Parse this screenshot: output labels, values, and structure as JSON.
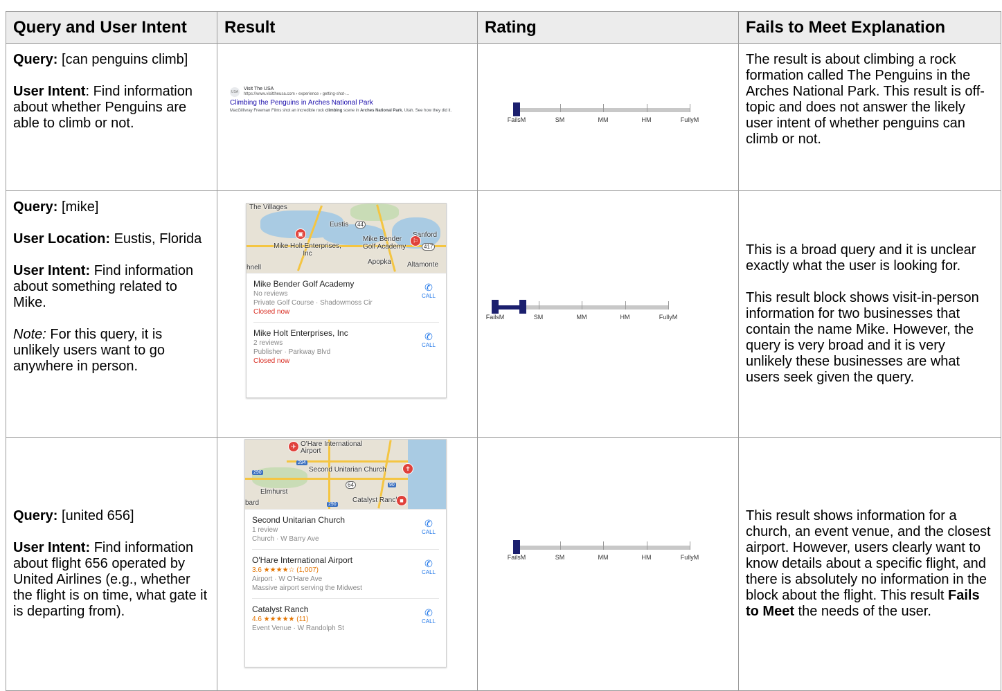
{
  "headers": [
    "Query and User Intent",
    "Result",
    "Rating",
    "Fails to Meet Explanation"
  ],
  "rows": [
    {
      "query_label": "Query:",
      "query": "[can penguins climb]",
      "intent_label": "User Intent",
      "intent": ": Find information about whether Penguins are able to climb or not.",
      "result": {
        "favicon": "USA",
        "site": "Visit The USA",
        "url": "https://www.visittheusa.com › experience › getting-shot-...",
        "title": "Climbing the Penguins in Arches National Park",
        "desc_a": "MacGillivray Freeman Films shot an incredible rock ",
        "desc_b": "climbing",
        "desc_c": " scene in ",
        "desc_d": "Arches National Park",
        "desc_e": ", Utah. See how they did it."
      },
      "rating": {
        "labels": [
          "FailsM",
          "SM",
          "MM",
          "HM",
          "FullyM"
        ],
        "value": 0.0,
        "range": [
          0.0,
          0.0
        ]
      },
      "explanation": "The result is about climbing a rock formation called The Penguins in the Arches National Park. This result is off-topic and does not answer the likely user intent of whether penguins can climb or not."
    },
    {
      "query_label": "Query:",
      "query": "[mike]",
      "location_label": "User Location:",
      "location": "Eustis, Florida",
      "intent_label": "User Intent:",
      "intent": "Find information about something related to Mike.",
      "note_label": "Note:",
      "note": "For this query, it is unlikely users want to go anywhere in person.",
      "result": {
        "map_labels": [
          "The Villages",
          "Eustis",
          "Sanford",
          "Mike Bender Golf Academy",
          "Mike Holt Enterprises, Inc",
          "Apopka",
          "Altamonte",
          "hnell"
        ],
        "shields": [
          "44",
          "417"
        ],
        "listings": [
          {
            "name": "Mike Bender Golf Academy",
            "reviews": "No reviews",
            "category": "Private Golf Course · Shadowmoss Cir",
            "status": "Closed now",
            "call": "CALL"
          },
          {
            "name": "Mike Holt Enterprises, Inc",
            "reviews": "2 reviews",
            "category": "Publisher · Parkway Blvd",
            "status": "Closed now",
            "call": "CALL"
          }
        ]
      },
      "rating": {
        "labels": [
          "FailsM",
          "SM",
          "MM",
          "HM",
          "FullyM"
        ],
        "value": 0.1,
        "range": [
          0.0,
          0.16
        ]
      },
      "explanation_1": "This is a broad query and it is unclear exactly what the user is looking for.",
      "explanation_2": "This result block shows visit-in-person information for two businesses that contain the name Mike.  However, the query is very broad and it is very unlikely these businesses are what users seek given the query."
    },
    {
      "query_label": "Query:",
      "query": "[united 656]",
      "intent_label": "User Intent:",
      "intent": "Find information about flight 656 operated by United Airlines (e.g., whether the flight is on time, what gate it is departing from).",
      "result": {
        "map_labels": [
          "O'Hare International Airport",
          "Second Unitarian Church",
          "Elmhurst",
          "Catalyst Ranch",
          "bard"
        ],
        "shields": [
          "294",
          "290",
          "64",
          "90",
          "290"
        ],
        "listings": [
          {
            "name": "Second Unitarian Church",
            "reviews": "1 review",
            "category": "Church · W Barry Ave",
            "call": "CALL"
          },
          {
            "name": "O'Hare International Airport",
            "rating": "3.6 ★★★★☆ (1,007)",
            "category": "Airport · W O'Hare Ave",
            "extra": "Massive airport serving the Midwest",
            "call": "CALL"
          },
          {
            "name": "Catalyst Ranch",
            "rating": "4.6 ★★★★★ (11)",
            "category": "Event Venue · W Randolph St",
            "call": "CALL"
          }
        ]
      },
      "rating": {
        "labels": [
          "FailsM",
          "SM",
          "MM",
          "HM",
          "FullyM"
        ],
        "value": 0.0,
        "range": [
          0.0,
          0.0
        ]
      },
      "explanation_a": "This result shows information for a church, an event venue, and the closest airport.  However, users clearly want to know details about a specific flight, and there is absolutely no information in the block about the flight.  This result ",
      "explanation_bold": "Fails to Meet",
      "explanation_b": " the needs of the user."
    }
  ],
  "colors": {
    "header_bg": "#ececec",
    "slider_fill": "#1b1f6e",
    "slider_track": "#c8c8c8",
    "link_blue": "#1a0dab",
    "closed_red": "#d93025",
    "star_orange": "#e37400"
  }
}
